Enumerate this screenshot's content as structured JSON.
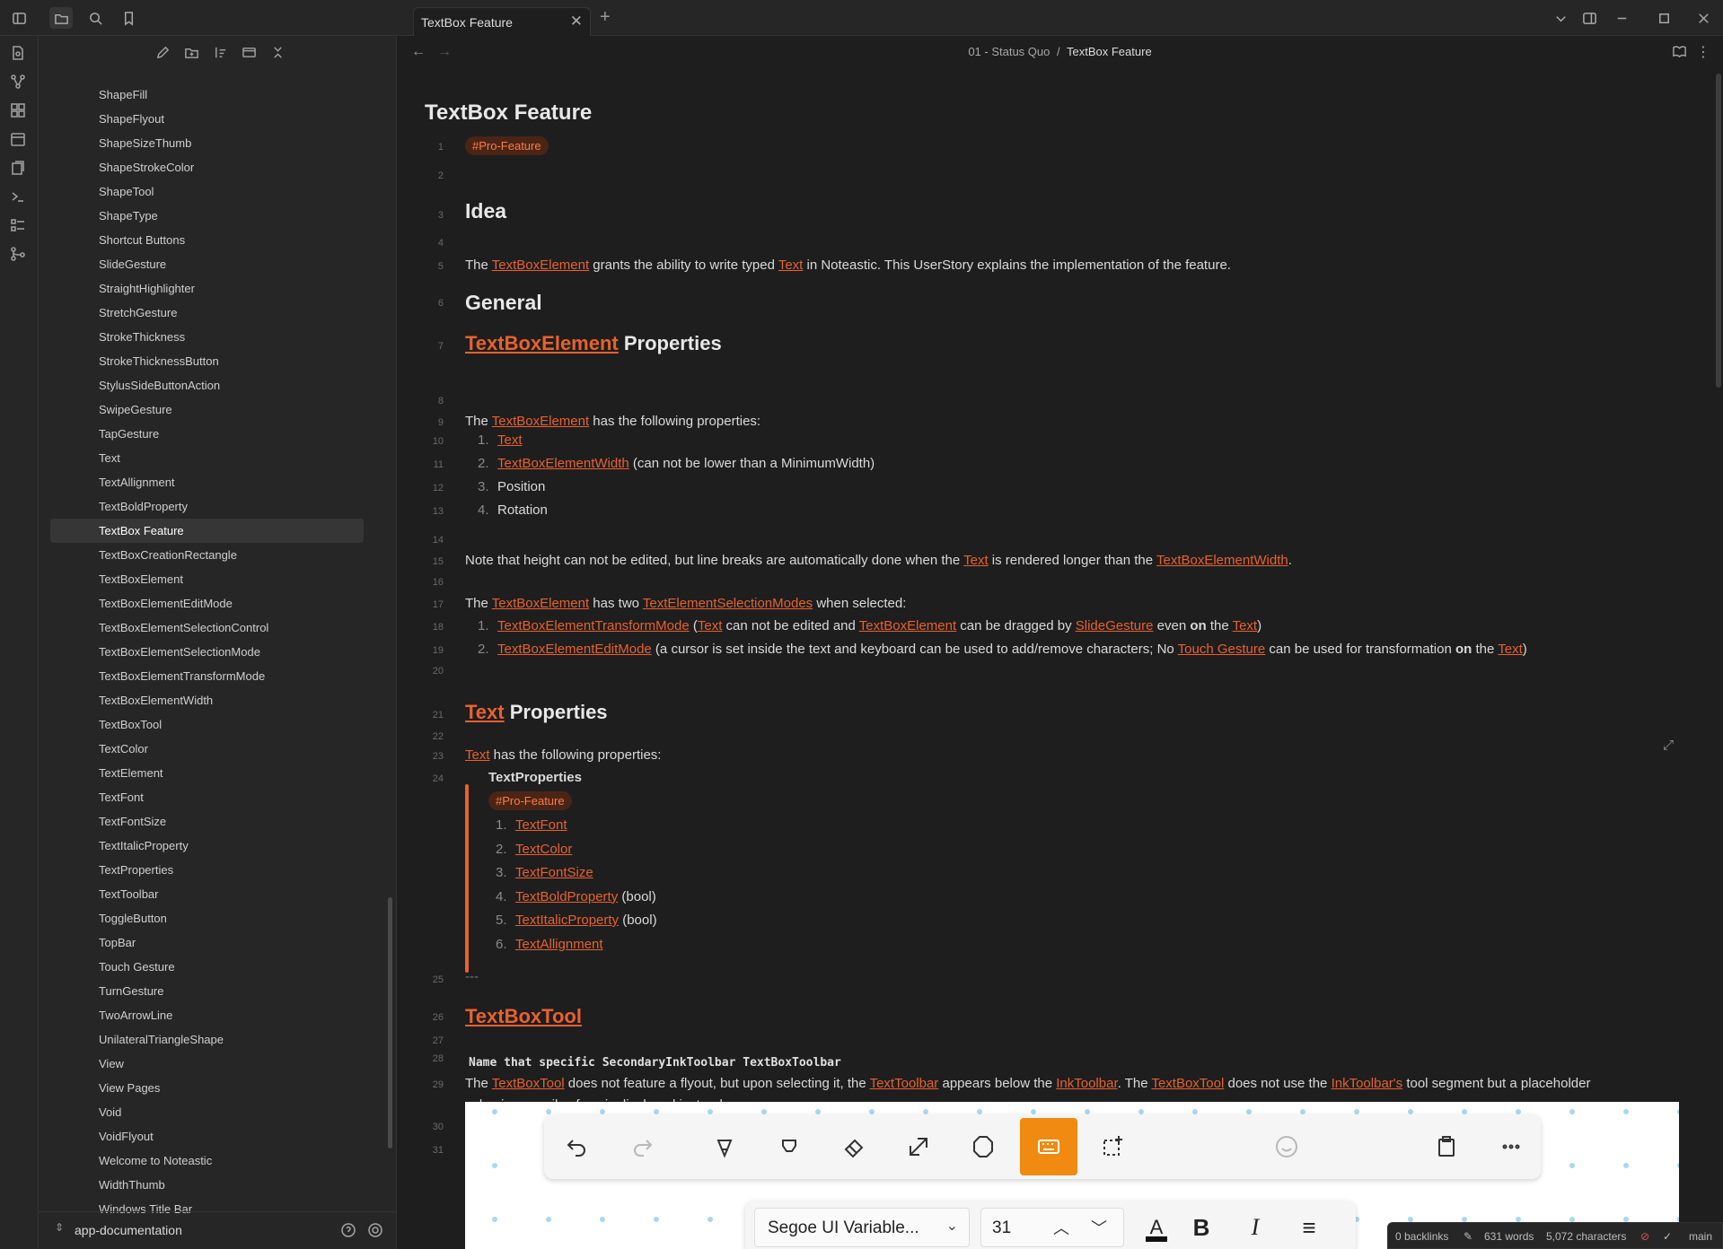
{
  "tab": {
    "title": "TextBox Feature",
    "close": "✕",
    "new": "+"
  },
  "breadcrumb": {
    "folder": "01 - Status Quo",
    "sep": "/",
    "current": "TextBox Feature"
  },
  "sidebar": {
    "files": [
      "ShapeFill",
      "ShapeFlyout",
      "ShapeSizeThumb",
      "ShapeStrokeColor",
      "ShapeTool",
      "ShapeType",
      "Shortcut Buttons",
      "SlideGesture",
      "StraightHighlighter",
      "StretchGesture",
      "StrokeThickness",
      "StrokeThicknessButton",
      "StylusSideButtonAction",
      "SwipeGesture",
      "TapGesture",
      "Text",
      "TextAllignment",
      "TextBoldProperty",
      "TextBox Feature",
      "TextBoxCreationRectangle",
      "TextBoxElement",
      "TextBoxElementEditMode",
      "TextBoxElementSelectionControl",
      "TextBoxElementSelectionMode",
      "TextBoxElementTransformMode",
      "TextBoxElementWidth",
      "TextBoxTool",
      "TextColor",
      "TextElement",
      "TextFont",
      "TextFontSize",
      "TextItalicProperty",
      "TextProperties",
      "TextToolbar",
      "ToggleButton",
      "TopBar",
      "Touch Gesture",
      "TurnGesture",
      "TwoArrowLine",
      "UnilateralTriangleShape",
      "View",
      "View Pages",
      "Void",
      "VoidFlyout",
      "Welcome to Noteastic",
      "WidthThumb",
      "Windows Title Bar"
    ],
    "active_index": 18,
    "vault": "app-documentation"
  },
  "doc": {
    "title": "TextBox Feature",
    "tag": "#Pro-Feature",
    "h_idea": "Idea",
    "l5": {
      "a": "The ",
      "b": "TextBoxElement",
      "c": " grants the ability to write typed ",
      "d": "Text",
      "e": " in Noteastic. This UserStory explains the implementation of the feature."
    },
    "h_general": "General",
    "h7": {
      "link": "TextBoxElement",
      "rest": " Properties"
    },
    "l9": {
      "a": "The ",
      "b": "TextBoxElement",
      "c": " has the following properties:"
    },
    "list1": [
      {
        "n": "1.",
        "link": "Text",
        "rest": ""
      },
      {
        "n": "2.",
        "link": "TextBoxElementWidth",
        "rest": " (can not be lower than a MinimumWidth)"
      },
      {
        "n": "3.",
        "link": "",
        "rest": "Position"
      },
      {
        "n": "4.",
        "link": "",
        "rest": "Rotation"
      }
    ],
    "l15": {
      "a": "Note that height can not be edited, but line breaks are automatically done when the ",
      "b": "Text",
      "c": " is rendered longer than the ",
      "d": "TextBoxElementWidth",
      "e": "."
    },
    "l17": {
      "a": "The ",
      "b": "TextBoxElement",
      "c": " has two ",
      "d": "TextElementSelectionModes",
      "e": " when selected:"
    },
    "l18": {
      "n": "1.",
      "a": "TextBoxElementTransformMode",
      "b": " (",
      "c": "Text",
      "d": " can not be edited and ",
      "e": "TextBoxElement",
      "f": " can be dragged by ",
      "g": "SlideGesture",
      "h": " even ",
      "i": "on",
      "j": " the ",
      "k": "Text",
      "l": ")"
    },
    "l19": {
      "n": "2.",
      "a": "TextBoxElementEditMode",
      "b": " (a cursor is set inside the text and keyboard can be used to add/remove characters; No ",
      "c": "Touch Gesture",
      "d": " can be used for transformation ",
      "e": "on",
      "f": " the ",
      "g": "Text",
      "h": ")"
    },
    "h21": {
      "link": "Text",
      "rest": " Properties"
    },
    "l23": {
      "a": "Text",
      "b": " has the following properties:"
    },
    "embed_title": "TextProperties",
    "embed_tag": "#Pro-Feature",
    "list2": [
      {
        "n": "1.",
        "link": "TextFont",
        "rest": ""
      },
      {
        "n": "2.",
        "link": "TextColor",
        "rest": ""
      },
      {
        "n": "3.",
        "link": "TextFontSize",
        "rest": ""
      },
      {
        "n": "4.",
        "link": "TextBoldProperty",
        "rest": " (bool)"
      },
      {
        "n": "5.",
        "link": "TextItalicProperty",
        "rest": " (bool)"
      },
      {
        "n": "6.",
        "link": "TextAllignment",
        "rest": ""
      }
    ],
    "l25": "---",
    "h26": "TextBoxTool",
    "l28": "Name that specific SecondaryInkToolbar TextBoxToolbar",
    "l29": {
      "a": "The ",
      "b": "TextBoxTool",
      "c": " does not feature a flyout, but upon selecting it, the ",
      "d": "TextToolbar",
      "e": " appears below the ",
      "f": "InkToolbar",
      "g": ". The ",
      "h": "TextBoxTool",
      "i": " does not use the ",
      "j": "InkToolbar's",
      "k": " tool segment but a placeholder"
    },
    "l29b": "value i.e. a smiley face is displayed instead.",
    "line_numbers": [
      "1",
      "2",
      "3",
      "4",
      "5",
      "6",
      "7",
      "8",
      "9",
      "10",
      "11",
      "12",
      "13",
      "14",
      "15",
      "16",
      "17",
      "18",
      "19",
      "20",
      "21",
      "22",
      "23",
      "24",
      "25",
      "26",
      "27",
      "28",
      "29",
      "30",
      "31"
    ]
  },
  "embedded_screenshot": {
    "font": "Segoe UI Variable...",
    "font_size": "31",
    "bold": "B",
    "italic": "I"
  },
  "statusbar": {
    "backlinks": "0 backlinks",
    "words": "631 words",
    "chars": "5,072 characters",
    "branch": "main"
  }
}
